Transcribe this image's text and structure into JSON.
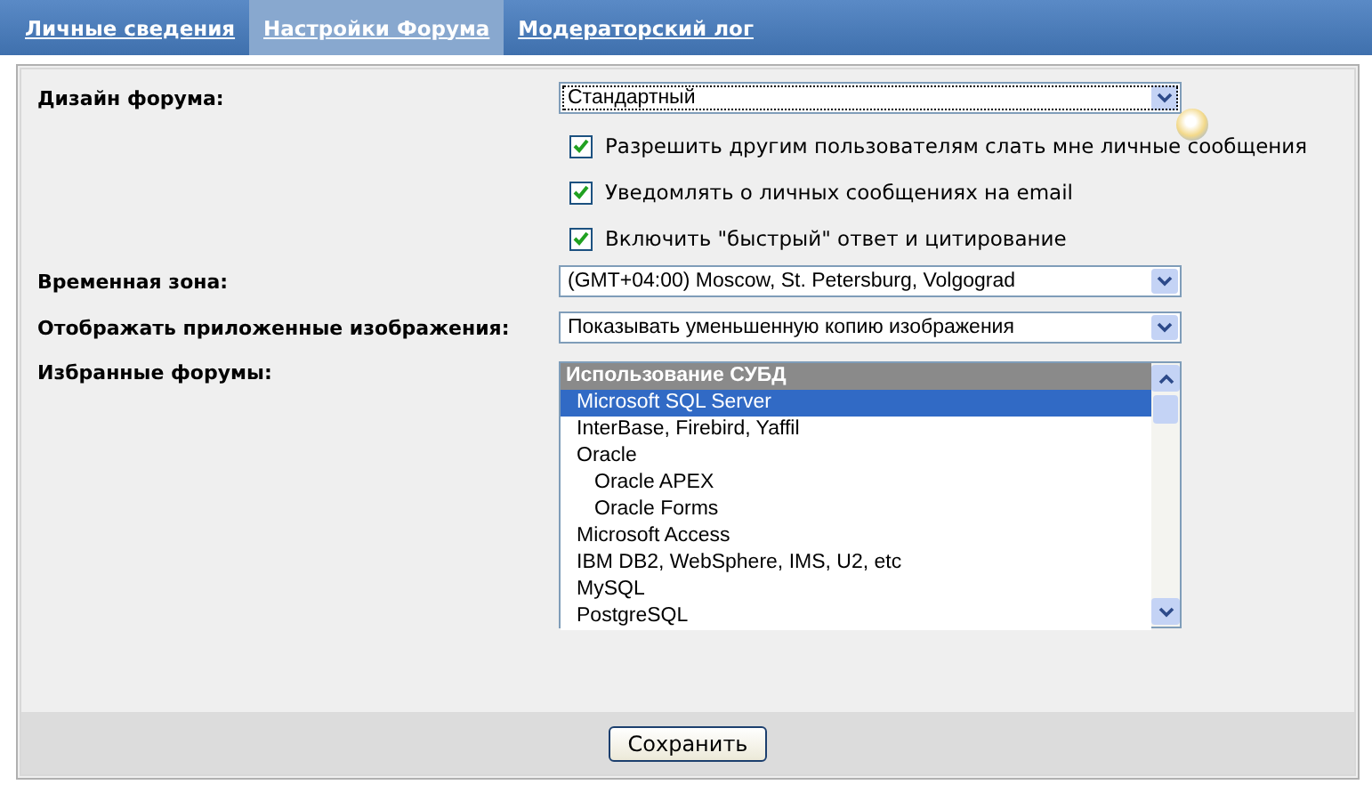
{
  "tabs": [
    {
      "label": "Личные сведения",
      "selected": false
    },
    {
      "label": "Настройки Форума",
      "selected": true
    },
    {
      "label": "Модераторский лог",
      "selected": false
    }
  ],
  "design": {
    "label": "Дизайн форума:",
    "value": "Стандартный"
  },
  "options": [
    {
      "label": "Разрешить другим пользователям слать мне личные сообщения",
      "checked": true
    },
    {
      "label": "Уведомлять о личных сообщениях на email",
      "checked": true
    },
    {
      "label": "Включить \"быстрый\" ответ и цитирование",
      "checked": true
    }
  ],
  "timezone": {
    "label": "Временная зона:",
    "value": "(GMT+04:00) Moscow, St. Petersburg, Volgograd"
  },
  "images": {
    "label": "Отображать приложенные изображения:",
    "value": "Показывать уменьшенную копию изображения"
  },
  "favorites": {
    "label": "Избранные форумы:",
    "items": [
      {
        "kind": "group",
        "label": "Использование СУБД"
      },
      {
        "kind": "option",
        "label": "Microsoft SQL Server",
        "selected": true
      },
      {
        "kind": "option",
        "label": "InterBase, Firebird, Yaffil",
        "selected": false
      },
      {
        "kind": "option",
        "label": "Oracle",
        "selected": false,
        "children": [
          {
            "kind": "option",
            "label": "Oracle APEX",
            "selected": false
          },
          {
            "kind": "option",
            "label": "Oracle Forms",
            "selected": false
          }
        ]
      },
      {
        "kind": "option",
        "label": "Microsoft Access",
        "selected": false
      },
      {
        "kind": "option",
        "label": "IBM DB2, WebSphere, IMS, U2, etc",
        "selected": false
      },
      {
        "kind": "option",
        "label": "MySQL",
        "selected": false
      },
      {
        "kind": "option",
        "label": "PostgreSQL",
        "selected": false
      }
    ]
  },
  "save_button": "Сохранить"
}
